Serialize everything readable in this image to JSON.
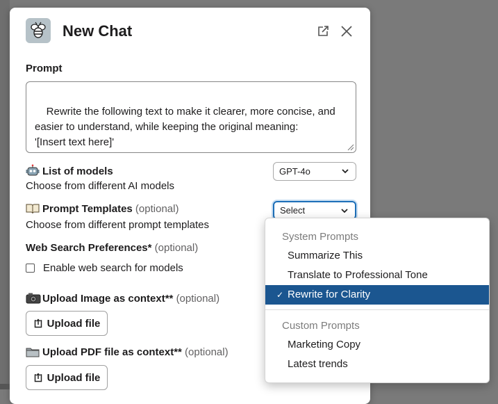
{
  "modal": {
    "title": "New Chat",
    "app_icon": "bee-icon",
    "header_icons": [
      "open-external-icon",
      "close-icon"
    ]
  },
  "prompt": {
    "label": "Prompt",
    "value": "Rewrite the following text to make it clearer, more concise, and easier to understand, while keeping the original meaning:\n'[Insert text here]'"
  },
  "models": {
    "label": "List of models",
    "description": "Choose from different AI models",
    "selected": "GPT-4o",
    "icon": "robot-icon"
  },
  "templates": {
    "label": "Prompt Templates",
    "optional": "(optional)",
    "description": "Choose from different prompt templates",
    "selected": "Select",
    "icon": "open-book-icon"
  },
  "web_search": {
    "label": "Web Search Preferences*",
    "optional": "(optional)",
    "checkbox_label": "Enable web search for models",
    "checked": false
  },
  "image_upload": {
    "label": "Upload Image as context**",
    "optional": "(optional)",
    "button": "Upload file",
    "icon": "camera-icon"
  },
  "pdf_upload": {
    "label": "Upload PDF file as context**",
    "optional": "(optional)",
    "button": "Upload file",
    "icon": "folder-icon"
  },
  "dropdown": {
    "groups": [
      {
        "name": "System Prompts",
        "items": [
          "Summarize This",
          "Translate to Professional Tone",
          "Rewrite for Clarity"
        ]
      },
      {
        "name": "Custom Prompts",
        "items": [
          "Marketing Copy",
          "Latest trends"
        ]
      }
    ],
    "selected_item": "Rewrite for Clarity",
    "selected_bg": "#1b5690"
  }
}
